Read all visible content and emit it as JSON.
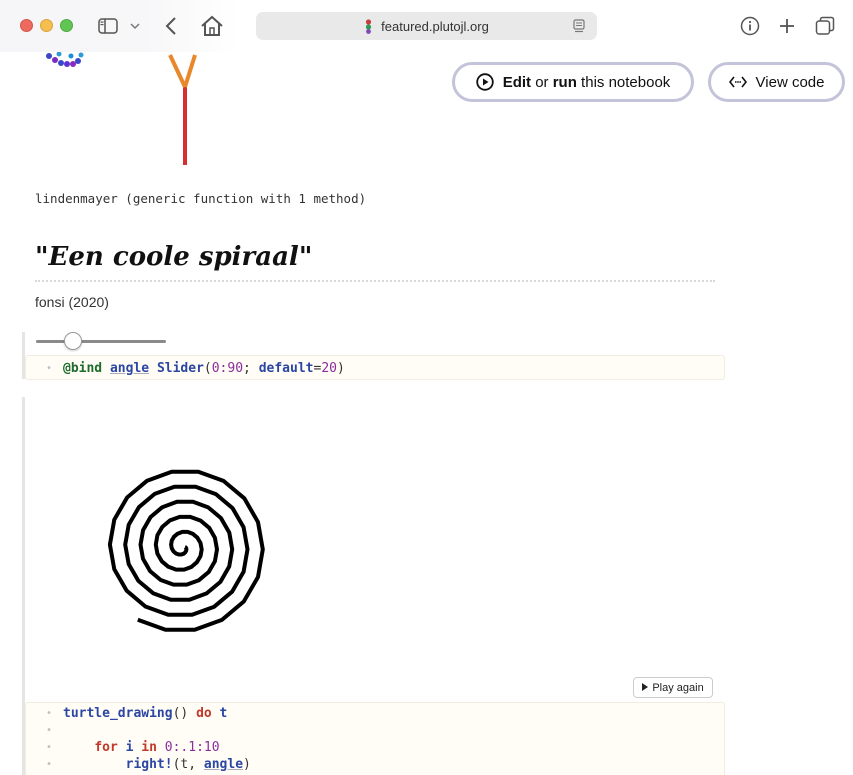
{
  "browser": {
    "url": "featured.plutojl.org",
    "icons": [
      "sidebar-icon",
      "chevron-down-icon",
      "back-icon",
      "home-icon",
      "info-icon",
      "plus-icon",
      "tabs-icon",
      "reader-icon"
    ]
  },
  "header_buttons": {
    "edit_strong1": "Edit",
    "edit_mid": " or ",
    "edit_strong2": "run",
    "edit_tail": " this notebook",
    "view_code": "View code"
  },
  "tree": {
    "stem_color": "#d62f2f",
    "branch_color": "#e8872b"
  },
  "output": {
    "text": "lindenmayer (generic function with 1 method)"
  },
  "section": {
    "title_quote_open": "\"",
    "title": "Een coole spiraal",
    "title_quote_close": "\"",
    "author": "fonsi (2020)"
  },
  "slider": {
    "min": 0,
    "max": 90,
    "value": 20
  },
  "bind_cell": {
    "line": {
      "macro": "@bind",
      "var": "angle",
      "fn": "Slider",
      "p1": "(",
      "range": "0:90",
      "p2": "; ",
      "kwname": "default",
      "eq": "=",
      "kwval": "20",
      "p3": ")"
    }
  },
  "turtle_cell": {
    "l1_fn": "turtle_drawing",
    "l1_paren": "() ",
    "l1_do": "do",
    "l1_t": " t",
    "l3_for": "for",
    "l3_i": " i ",
    "l3_in": "in",
    "l3_range": " 0:.1:10",
    "l4_fn": "right!",
    "l4_args1": "(t, ",
    "l4_angle": "angle",
    "l4_args2": ")"
  },
  "play_again": "Play again",
  "spiral": {
    "stroke_color": "#000000",
    "angle_deg": 20
  }
}
